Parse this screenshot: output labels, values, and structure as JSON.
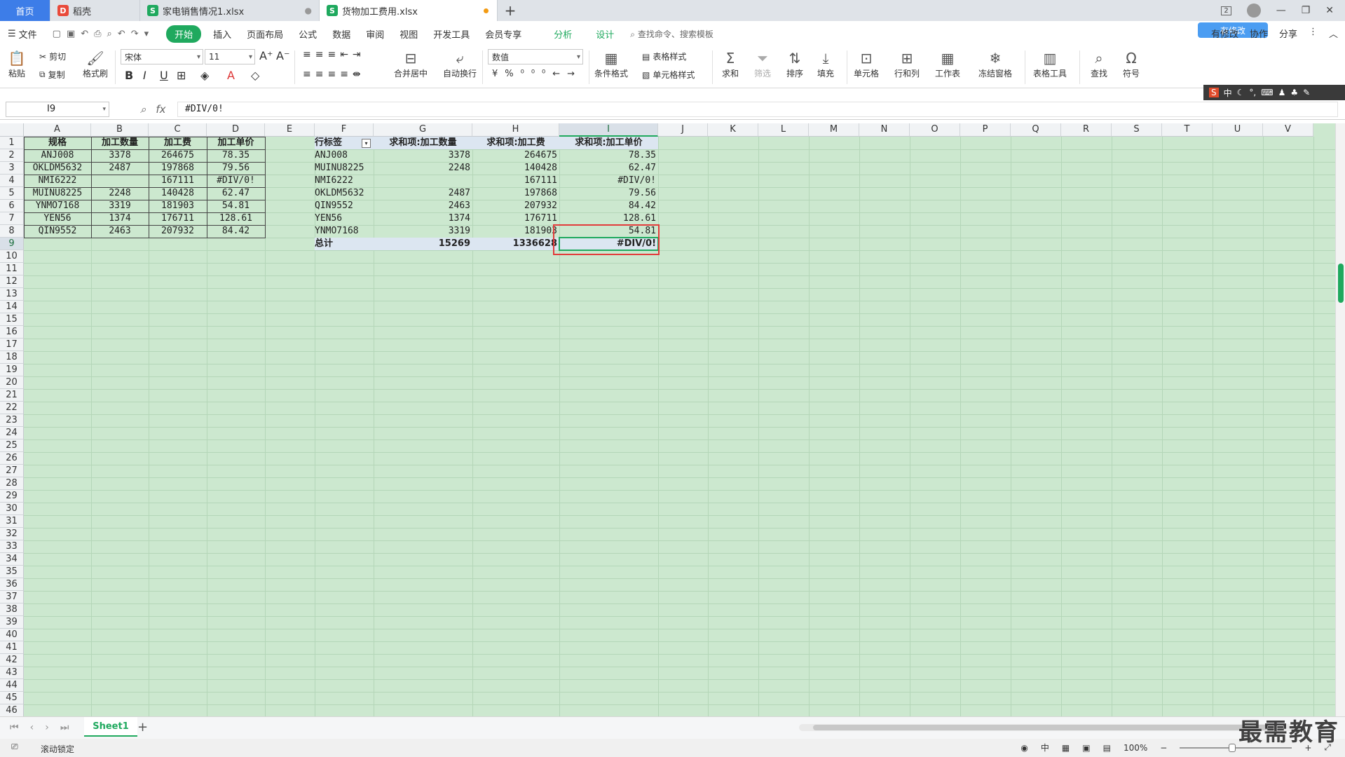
{
  "tabs": [
    {
      "label": "首页"
    },
    {
      "label": "稻壳"
    },
    {
      "label": "家电销售情况1.xlsx"
    },
    {
      "label": "货物加工费用.xlsx"
    }
  ],
  "window_controls": {
    "badge": "2"
  },
  "menu": {
    "file": "文件",
    "items": [
      "开始",
      "插入",
      "页面布局",
      "公式",
      "数据",
      "审阅",
      "视图",
      "开发工具",
      "会员专享"
    ],
    "context_items": [
      "分析",
      "设计"
    ],
    "search_placeholder": "查找命令、搜索模板",
    "right": [
      "有修改",
      "协作",
      "分享"
    ],
    "cloud_badge": "有修改"
  },
  "ribbon": {
    "paste": "粘贴",
    "cut": "剪切",
    "copy": "复制",
    "format_painter": "格式刷",
    "font_name": "宋体",
    "font_size": "11",
    "merge": "合并居中",
    "wrap": "自动换行",
    "number_format": "数值",
    "cond_format": "条件格式",
    "table_style": "表格样式",
    "cell_style": "单元格样式",
    "sum": "求和",
    "filter": "筛选",
    "sort": "排序",
    "fill": "填充",
    "cell": "单元格",
    "rowcol": "行和列",
    "worksheet": "工作表",
    "freeze": "冻结窗格",
    "table_tools": "表格工具",
    "find": "查找",
    "symbol": "符号"
  },
  "ime": {
    "label": "中"
  },
  "formula_bar": {
    "name_box": "I9",
    "formula": "#DIV/0!"
  },
  "columns": [
    "A",
    "B",
    "C",
    "D",
    "E",
    "F",
    "G",
    "H",
    "I",
    "J",
    "K",
    "L",
    "M",
    "N",
    "O",
    "P",
    "Q",
    "R",
    "S",
    "T",
    "U",
    "V"
  ],
  "selected_column": "I",
  "selected_row": 9,
  "rows": 46,
  "source_table": {
    "headers": [
      "规格",
      "加工数量",
      "加工费",
      "加工单价"
    ],
    "rows": [
      [
        "ANJ008",
        "3378",
        "264675",
        "78.35"
      ],
      [
        "OKLDM5632",
        "2487",
        "197868",
        "79.56"
      ],
      [
        "NMI6222",
        "",
        "167111",
        "#DIV/0!"
      ],
      [
        "MUINU8225",
        "2248",
        "140428",
        "62.47"
      ],
      [
        "YNMO7168",
        "3319",
        "181903",
        "54.81"
      ],
      [
        "YEN56",
        "1374",
        "176711",
        "128.61"
      ],
      [
        "QIN9552",
        "2463",
        "207932",
        "84.42"
      ]
    ]
  },
  "pivot_table": {
    "headers": [
      "行标签",
      "求和项:加工数量",
      "求和项:加工费",
      "求和项:加工单价"
    ],
    "rows": [
      [
        "ANJ008",
        "3378",
        "264675",
        "78.35"
      ],
      [
        "MUINU8225",
        "2248",
        "140428",
        "62.47"
      ],
      [
        "NMI6222",
        "",
        "167111",
        "#DIV/0!"
      ],
      [
        "OKLDM5632",
        "2487",
        "197868",
        "79.56"
      ],
      [
        "QIN9552",
        "2463",
        "207932",
        "84.42"
      ],
      [
        "YEN56",
        "1374",
        "176711",
        "128.61"
      ],
      [
        "YNMO7168",
        "3319",
        "181903",
        "54.81"
      ]
    ],
    "total": [
      "总计",
      "15269",
      "1336628",
      "#DIV/0!"
    ]
  },
  "sheets": [
    "Sheet1"
  ],
  "status": {
    "left": "滚动锁定",
    "zoom": "100%",
    "lang": "中"
  },
  "watermark": "最需教育",
  "colors": {
    "accent": "#1fa95e",
    "grid_bg": "#cce8cf",
    "highlight": "#e23b3b",
    "tab_active": "#3d7de8"
  }
}
